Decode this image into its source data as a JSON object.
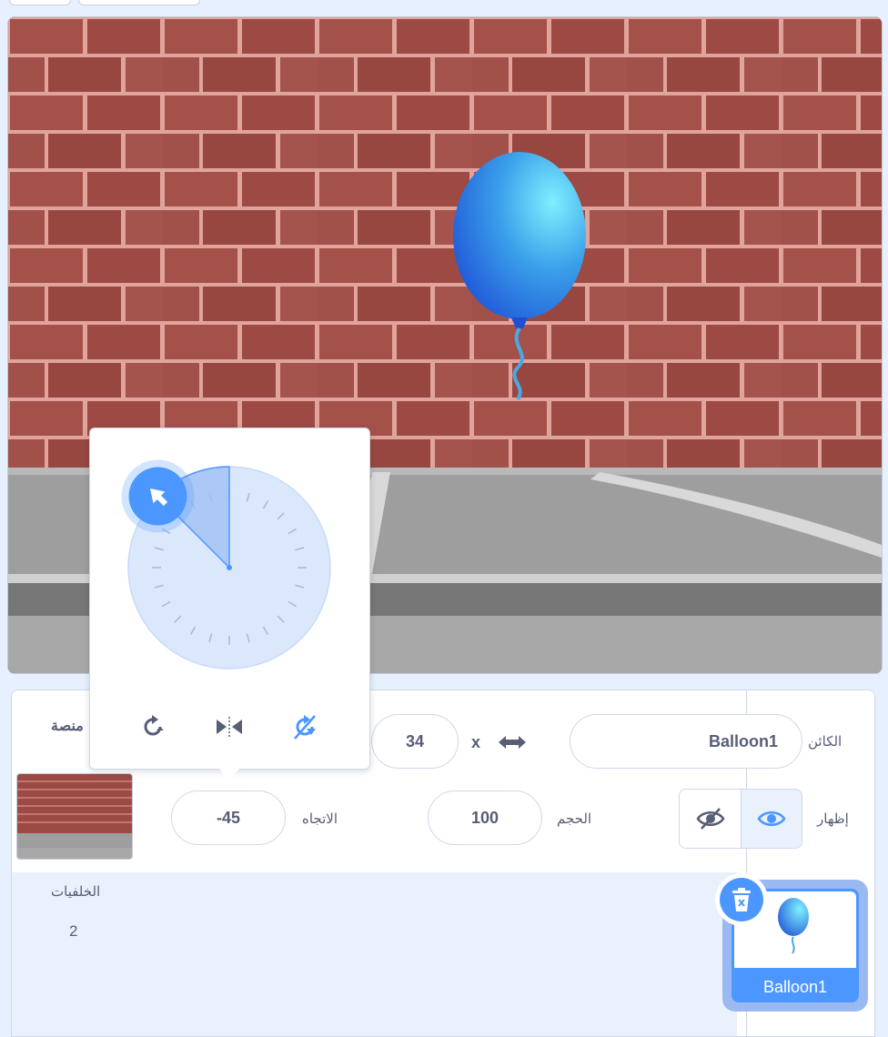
{
  "stage": {
    "sprite_name": "Balloon1"
  },
  "sprite_info": {
    "sprite_label": "الكائن",
    "sprite_name_value": "Balloon1",
    "x_label": "x",
    "x_value": "34",
    "show_label": "إظهار",
    "size_label": "الحجم",
    "size_value": "100",
    "direction_label": "الاتجاه",
    "direction_value": "-45"
  },
  "stage_panel": {
    "title": "منصة",
    "backdrops_label": "الخلفيات",
    "backdrops_count": "2"
  },
  "sprite_list": [
    {
      "name": "Balloon1",
      "selected": true
    }
  ],
  "direction_popup": {
    "direction": -45,
    "rotation_styles": [
      "all-around",
      "left-right",
      "dont-rotate"
    ],
    "active_style": "dont-rotate"
  },
  "colors": {
    "accent": "#4c97ff",
    "panel_bg": "#e6f0ff",
    "text": "#575e75"
  }
}
